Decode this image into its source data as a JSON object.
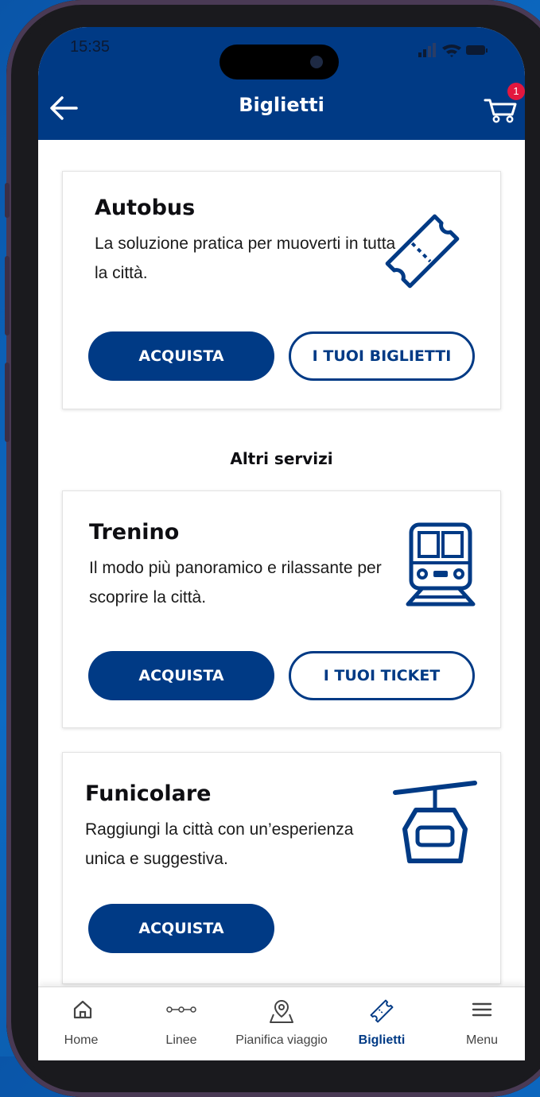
{
  "status_bar": {
    "time": "15:35"
  },
  "header": {
    "title": "Biglietti",
    "cart_count": "1"
  },
  "cards": [
    {
      "title": "Autobus",
      "description": "La soluzione pratica per muoverti in tutta la città.",
      "icon": "ticket-icon",
      "primary_label": "ACQUISTA",
      "secondary_label": "I TUOI BIGLIETTI"
    },
    {
      "title": "Trenino",
      "description": "Il modo più panoramico e rilassante per scoprire la città.",
      "icon": "train-icon",
      "primary_label": "ACQUISTA",
      "secondary_label": "I TUOI TICKET"
    },
    {
      "title": "Funicolare",
      "description": "Raggiungi la città con un’esperienza unica e suggestiva.",
      "icon": "cable-car-icon",
      "primary_label": "ACQUISTA"
    }
  ],
  "section_title": "Altri servizi",
  "tabbar": {
    "items": [
      {
        "label": "Home",
        "icon": "home-icon"
      },
      {
        "label": "Linee",
        "icon": "route-icon"
      },
      {
        "label": "Pianifica viaggio",
        "icon": "map-pin-icon"
      },
      {
        "label": "Biglietti",
        "icon": "ticket-icon",
        "active": true
      },
      {
        "label": "Menu",
        "icon": "hamburger-icon"
      }
    ]
  },
  "colors": {
    "brand": "#003a85",
    "badge": "#e3173e",
    "background": "#0a55a8"
  }
}
